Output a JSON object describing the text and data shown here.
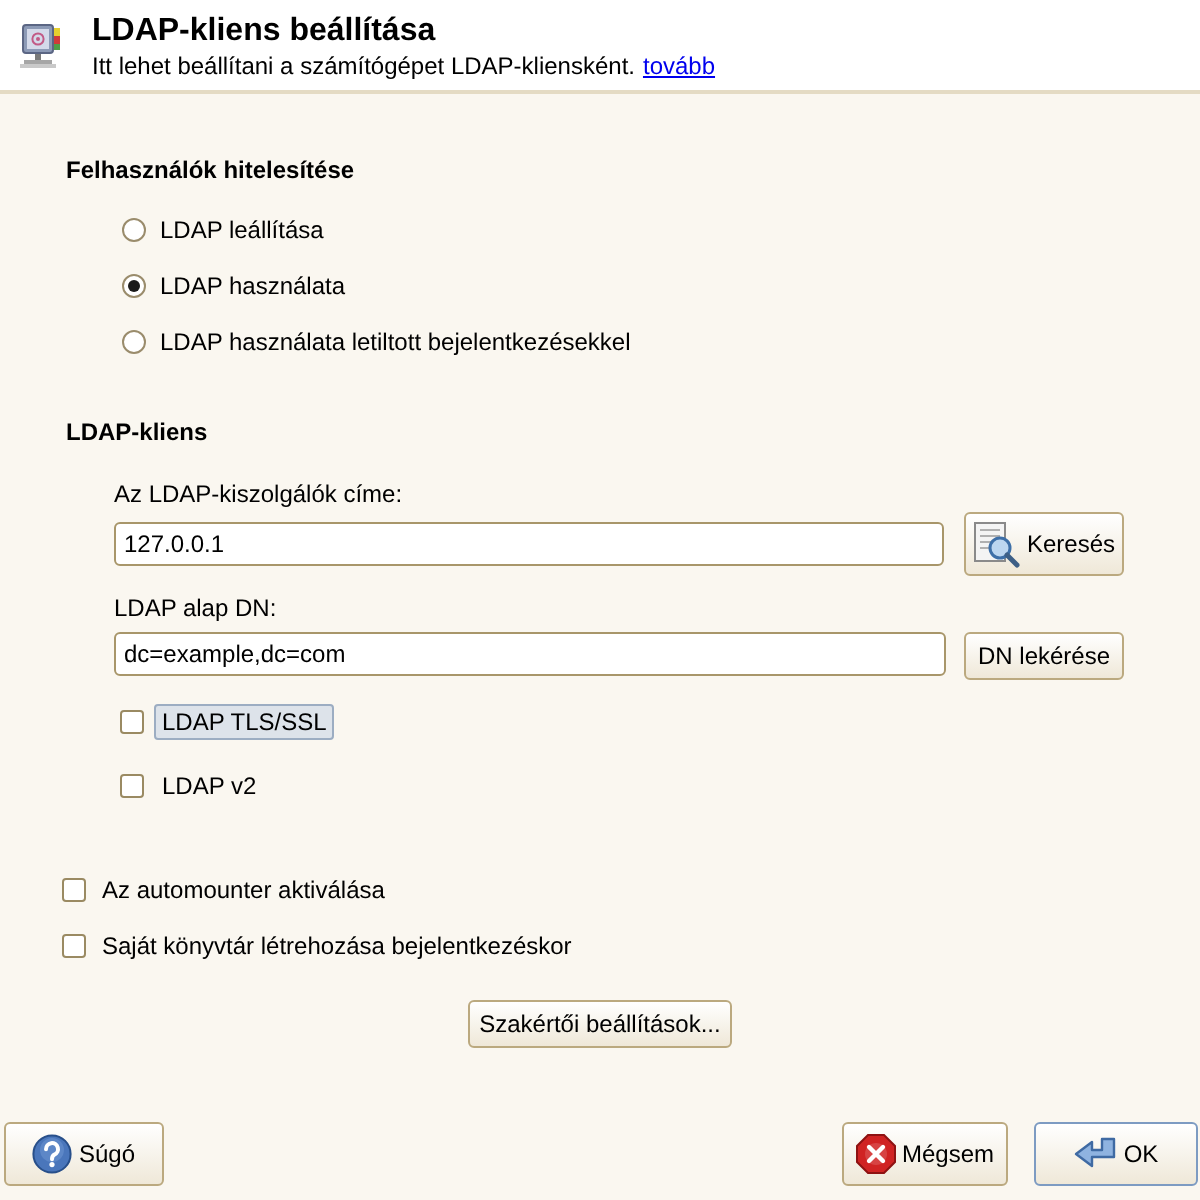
{
  "header": {
    "title": "LDAP-kliens beállítása",
    "subtitle": "Itt lehet beállítani a számítógépet LDAP-kliensként.",
    "link": "tovább"
  },
  "auth_section": {
    "heading": "Felhasználók hitelesítése",
    "options": [
      {
        "label": "LDAP leállítása",
        "selected": false
      },
      {
        "label": "LDAP használata",
        "selected": true
      },
      {
        "label": "LDAP használata letiltott bejelentkezésekkel",
        "selected": false
      }
    ]
  },
  "client_section": {
    "heading": "LDAP-kliens",
    "fields": [
      {
        "label": "Az LDAP-kiszolgálók címe:",
        "value": "127.0.0.1",
        "button": {
          "kind": "search",
          "label": "Keresés"
        }
      },
      {
        "label": "LDAP alap DN:",
        "value": "dc=example,dc=com",
        "button": {
          "kind": "plain",
          "label": "DN lekérése"
        }
      }
    ],
    "checkboxes": [
      {
        "label": "LDAP TLS/SSL",
        "checked": false,
        "focused": true
      },
      {
        "label": "LDAP v2",
        "checked": false,
        "focused": false
      }
    ]
  },
  "options": [
    {
      "label": "Az automounter aktiválása",
      "checked": false
    },
    {
      "label": "Saját könyvtár létrehozása bejelentkezéskor",
      "checked": false
    }
  ],
  "expert_button": {
    "label": "Szakértői beállítások..."
  },
  "footer_buttons": [
    {
      "kind": "help",
      "label": "Súgó",
      "default": false
    },
    {
      "kind": "cancel",
      "label": "Mégsem",
      "default": false
    },
    {
      "kind": "ok",
      "label": "OK",
      "default": true
    }
  ]
}
